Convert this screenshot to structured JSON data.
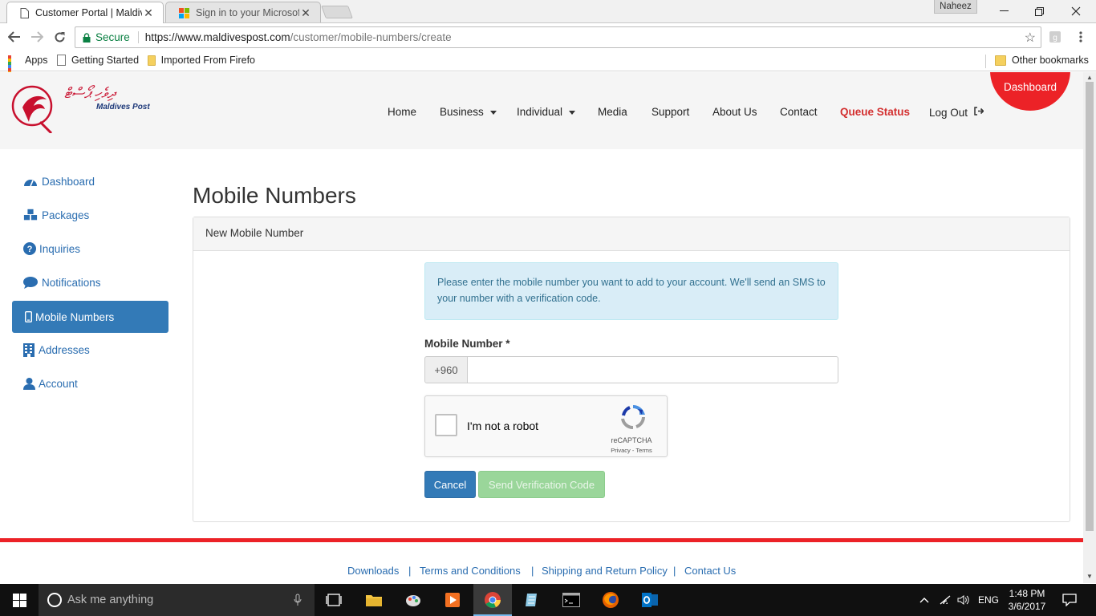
{
  "browser": {
    "tabs": [
      {
        "title": "Customer Portal | Maldiv",
        "close": "✕"
      },
      {
        "title": "Sign in to your Microsoft",
        "close": "✕"
      }
    ],
    "profile": "Naheez",
    "secure_label": "Secure",
    "url_host": "https://www.maldivespost.com",
    "url_path": "/customer/mobile-numbers/create",
    "bookmarks": [
      "Apps",
      "Getting Started",
      "Imported From Firefo",
      "Other bookmarks"
    ]
  },
  "site": {
    "logo_dhivehi": "ދިވެހި ޕޯސްޓް",
    "logo_text": "Maldives Post",
    "nav": [
      "Home",
      "Business",
      "Individual",
      "Media",
      "Support",
      "About Us",
      "Contact",
      "Queue Status",
      "Log Out"
    ],
    "dashboard_circle": "Dashboard"
  },
  "sidebar": {
    "items": [
      {
        "label": "Dashboard"
      },
      {
        "label": "Packages"
      },
      {
        "label": "Inquiries"
      },
      {
        "label": "Notifications"
      },
      {
        "label": "Mobile Numbers"
      },
      {
        "label": "Addresses"
      },
      {
        "label": "Account"
      }
    ]
  },
  "main": {
    "title": "Mobile Numbers",
    "panel_heading": "New Mobile Number",
    "alert": "Please enter the mobile number you want to add to your account. We'll send an SMS to your number with a verification code.",
    "field_label": "Mobile Number *",
    "country_code": "+960",
    "mobile_value": "",
    "captcha_label": "I'm not a robot",
    "captcha_brand": "reCAPTCHA",
    "captcha_terms": "Privacy - Terms",
    "cancel": "Cancel",
    "send": "Send Verification Code"
  },
  "footer": {
    "links": [
      "Downloads",
      "Terms and Conditions",
      "Shipping and Return Policy",
      "Contact Us"
    ],
    "sep": "|"
  },
  "taskbar": {
    "search_placeholder": "Ask me anything",
    "lang": "ENG",
    "time": "1:48 PM",
    "date": "3/6/2017"
  },
  "colors": {
    "accent": "#ec2227",
    "primary": "#337ab7",
    "success_disabled": "#9ad69a",
    "info_bg": "#d9edf7"
  }
}
